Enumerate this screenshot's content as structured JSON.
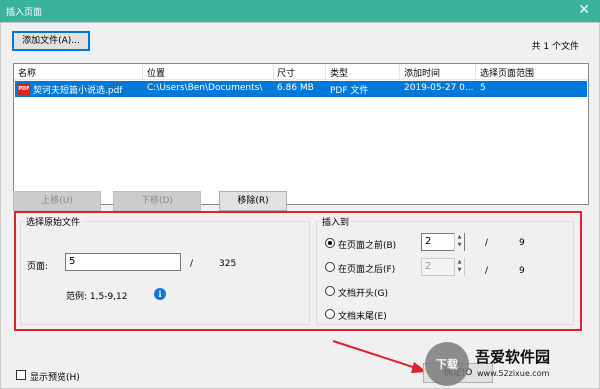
{
  "window": {
    "title": "插入页面",
    "close_glyph": "✕"
  },
  "toolbar": {
    "add_file_label": "添加文件(A)...",
    "file_count": "共 1 个文件"
  },
  "file_list": {
    "columns": [
      "名称",
      "位置",
      "尺寸",
      "类型",
      "添加时间",
      "选择页面范围"
    ],
    "rows": [
      {
        "icon": "pdf-icon",
        "icon_text": "PDF",
        "name": "契诃夫短篇小说选.pdf",
        "location": "C:\\Users\\Ben\\Documents\\",
        "size": "6.86 MB",
        "type": "PDF 文件",
        "added": "2019-05-27 0...",
        "range": "5"
      }
    ]
  },
  "list_actions": {
    "move_up": "上移(U)",
    "move_down": "下移(D)",
    "remove": "移除(R)"
  },
  "source_group": {
    "label": "选择原始文件",
    "page_label": "页面:",
    "page_value": "5",
    "total_pages": "325",
    "separator": "/",
    "example": "范例: 1,5-9,12"
  },
  "insert_group": {
    "label": "插入到",
    "options": [
      {
        "label": "在页面之前(B)",
        "selected": true,
        "value": "2",
        "total": "9"
      },
      {
        "label": "在页面之后(F)",
        "selected": false,
        "value": "2",
        "total": "9"
      },
      {
        "label": "文档开头(G)",
        "selected": false
      },
      {
        "label": "文档末尾(E)",
        "selected": false
      }
    ],
    "separator": "/"
  },
  "footer": {
    "preview_label": "显示预览(H)",
    "ok_label": "确定(O",
    "watermark_title": "吾爱软件园",
    "watermark_url": "www.52zixue.com",
    "watermark_logo_text": "下载"
  },
  "colors": {
    "titlebar": "#3bb29a",
    "selection": "#0078d7",
    "highlight_box": "#d9232d",
    "info": "#1874d2"
  }
}
